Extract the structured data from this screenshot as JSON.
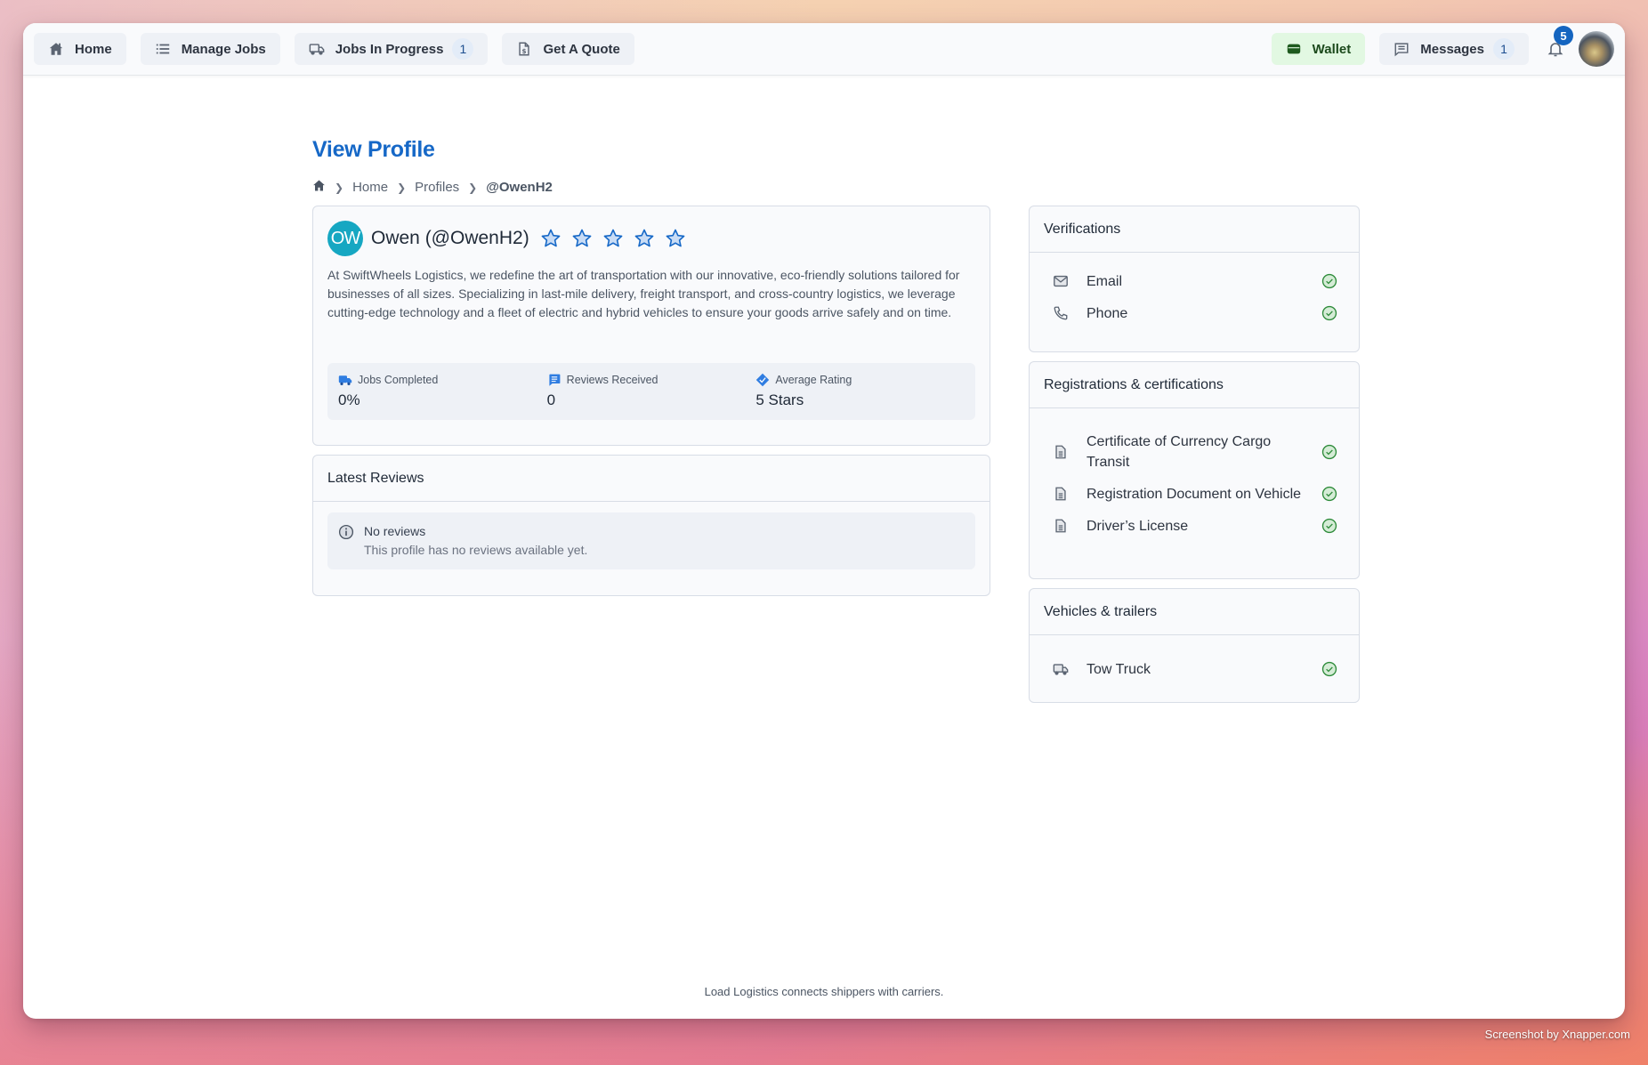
{
  "nav": {
    "items": [
      {
        "label": "Home",
        "icon": "home-icon"
      },
      {
        "label": "Manage Jobs",
        "icon": "list-icon"
      },
      {
        "label": "Jobs In Progress",
        "icon": "truck-icon",
        "badge": "1"
      },
      {
        "label": "Get A Quote",
        "icon": "document-dollar-icon"
      }
    ],
    "wallet_label": "Wallet",
    "messages_label": "Messages",
    "messages_badge": "1",
    "notifications_badge": "5"
  },
  "page": {
    "title": "View Profile",
    "breadcrumb": [
      "Home",
      "Profiles",
      "@OwenH2"
    ]
  },
  "profile": {
    "initials": "OW",
    "name": "Owen (@OwenH2)",
    "rating_stars": 5,
    "rating_max": 5,
    "bio": "At SwiftWheels Logistics, we redefine the art of transportation with our innovative, eco-friendly solutions tailored for businesses of all sizes. Specializing in last-mile delivery, freight transport, and cross-country logistics, we leverage cutting-edge technology and a fleet of electric and hybrid vehicles to ensure your goods arrive safely and on time.",
    "stats": [
      {
        "label": "Jobs Completed",
        "value": "0%",
        "icon": "truck-icon"
      },
      {
        "label": "Reviews Received",
        "value": "0",
        "icon": "chat-icon"
      },
      {
        "label": "Average Rating",
        "value": "5 Stars",
        "icon": "badge-icon"
      }
    ]
  },
  "reviews": {
    "title": "Latest Reviews",
    "empty_title": "No reviews",
    "empty_message": "This profile has no reviews available yet."
  },
  "verifications": {
    "title": "Verifications",
    "items": [
      {
        "label": "Email",
        "icon": "mail-icon",
        "verified": true
      },
      {
        "label": "Phone",
        "icon": "phone-icon",
        "verified": true
      }
    ]
  },
  "registrations": {
    "title": "Registrations & certifications",
    "items": [
      {
        "label": "Certificate of Currency Cargo Transit",
        "icon": "document-icon",
        "verified": true
      },
      {
        "label": "Registration Document on Vehicle",
        "icon": "document-icon",
        "verified": true
      },
      {
        "label": "Driver’s License",
        "icon": "document-icon",
        "verified": true
      }
    ]
  },
  "vehicles": {
    "title": "Vehicles & trailers",
    "items": [
      {
        "label": "Tow Truck",
        "icon": "truck-icon",
        "verified": true
      }
    ]
  },
  "footer": {
    "text": "Load Logistics connects shippers with carriers."
  },
  "watermark": "Screenshot by Xnapper.com",
  "colors": {
    "accent": "#1668c7",
    "avatar_bg": "#16a7c2",
    "verified_green": "#2e8b3a",
    "wallet_bg": "#e2f8e2"
  }
}
